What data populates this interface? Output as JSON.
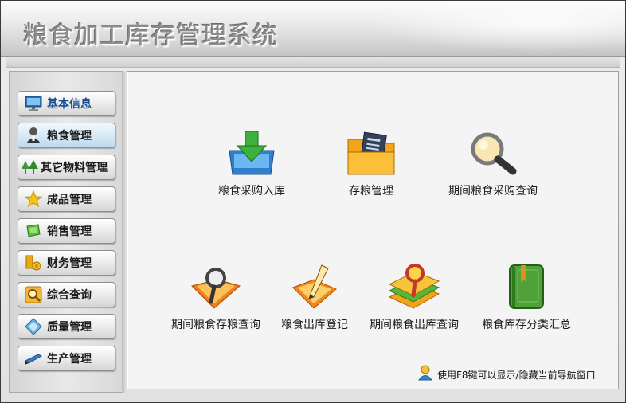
{
  "app": {
    "title": "粮食加工库存管理系统"
  },
  "sidebar": {
    "items": [
      {
        "label": "基本信息",
        "icon": "monitor-icon"
      },
      {
        "label": "粮食管理",
        "icon": "user-icon",
        "active": true
      },
      {
        "label": "其它物料管理",
        "icon": "trees-icon"
      },
      {
        "label": "成品管理",
        "icon": "star-icon"
      },
      {
        "label": "销售管理",
        "icon": "ticket-icon"
      },
      {
        "label": "财务管理",
        "icon": "coins-icon"
      },
      {
        "label": "综合查询",
        "icon": "search-panel-icon"
      },
      {
        "label": "质量管理",
        "icon": "diamond-icon"
      },
      {
        "label": "生产管理",
        "icon": "pen-icon"
      }
    ]
  },
  "main": {
    "tiles": [
      {
        "label": "粮食采购入库",
        "icon": "download-box-icon"
      },
      {
        "label": "存粮管理",
        "icon": "folder-document-icon"
      },
      {
        "label": "期间粮食采购查询",
        "icon": "magnifier-icon"
      },
      {
        "label": "期间粮食存粮查询",
        "icon": "folder-magnifier-icon"
      },
      {
        "label": "粮食出库登记",
        "icon": "folder-pen-icon"
      },
      {
        "label": "期间粮食出库查询",
        "icon": "books-magnifier-icon"
      },
      {
        "label": "粮食库存分类汇总",
        "icon": "green-book-icon"
      }
    ]
  },
  "status": {
    "tip": "使用F8键可以显示/隐藏当前导航窗口",
    "icon": "user-hint-icon"
  },
  "colors": {
    "active_nav": "#cfe4f5",
    "content_bg": "#f4f4f4",
    "title_text": "#8c8c8c"
  }
}
